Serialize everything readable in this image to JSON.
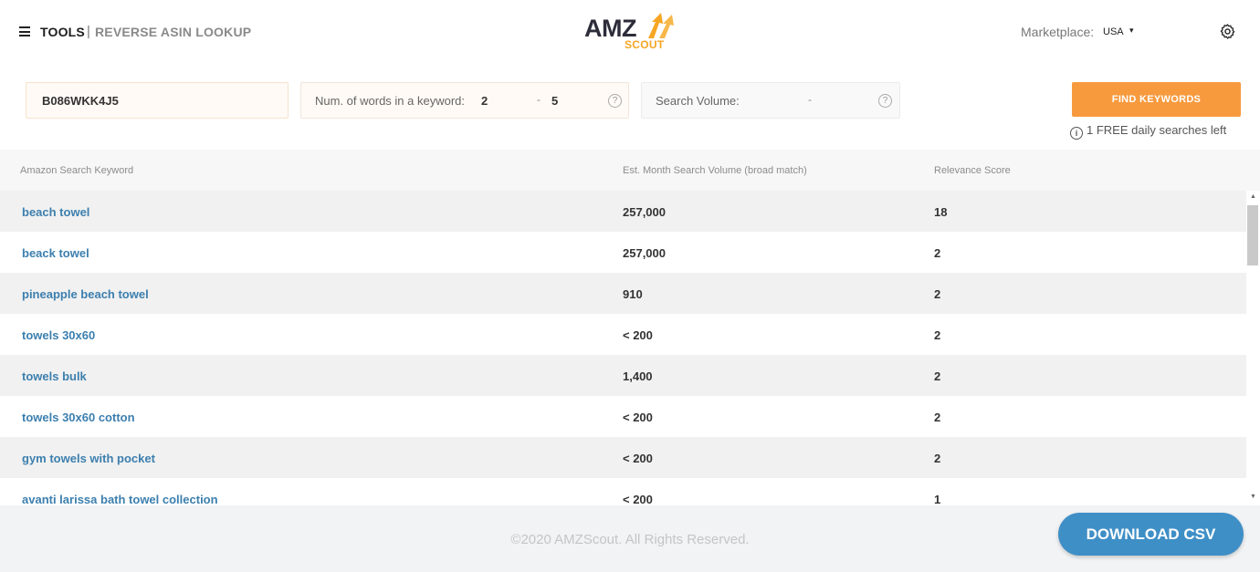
{
  "header": {
    "tools_label": "TOOLS",
    "separator": "|",
    "breadcrumb": "REVERSE ASIN LOOKUP",
    "logo_text": "AMZ",
    "logo_subtext": "SCOUT",
    "marketplace_label": "Marketplace:",
    "marketplace_value": "USA",
    "marketplace_caret": "▾"
  },
  "filters": {
    "asin_value": "B086WKK4J5",
    "words_label": "Num. of words in a keyword:",
    "words_min": "2",
    "words_sep": "-",
    "words_max": "5",
    "words_help": "?",
    "volume_label": "Search Volume:",
    "volume_sep": "-",
    "volume_help": "?",
    "find_button": "FIND KEYWORDS",
    "info_icon": "i",
    "free_searches": "1 FREE daily searches left"
  },
  "table": {
    "columns": [
      "Amazon Search Keyword",
      "Est. Month Search Volume (broad match)",
      "Relevance Score"
    ],
    "rows": [
      {
        "keyword": "beach towel",
        "volume": "257,000",
        "relevance": "18"
      },
      {
        "keyword": "beack towel",
        "volume": "257,000",
        "relevance": "2"
      },
      {
        "keyword": "pineapple beach towel",
        "volume": "910",
        "relevance": "2"
      },
      {
        "keyword": "towels 30x60",
        "volume": "< 200",
        "relevance": "2"
      },
      {
        "keyword": "towels bulk",
        "volume": "1,400",
        "relevance": "2"
      },
      {
        "keyword": "towels 30x60 cotton",
        "volume": "< 200",
        "relevance": "2"
      },
      {
        "keyword": "gym towels with pocket",
        "volume": "< 200",
        "relevance": "2"
      },
      {
        "keyword": "avanti larissa bath towel collection",
        "volume": "< 200",
        "relevance": "1"
      }
    ]
  },
  "scroll": {
    "up": "▲",
    "down": "▼"
  },
  "footer": {
    "copyright": "©2020 AMZScout. All Rights Reserved.",
    "download_button": "DOWNLOAD CSV"
  },
  "colors": {
    "accent_orange": "#f79a3e",
    "link_blue": "#3c7fae",
    "csv_blue": "#3f8fc7"
  }
}
